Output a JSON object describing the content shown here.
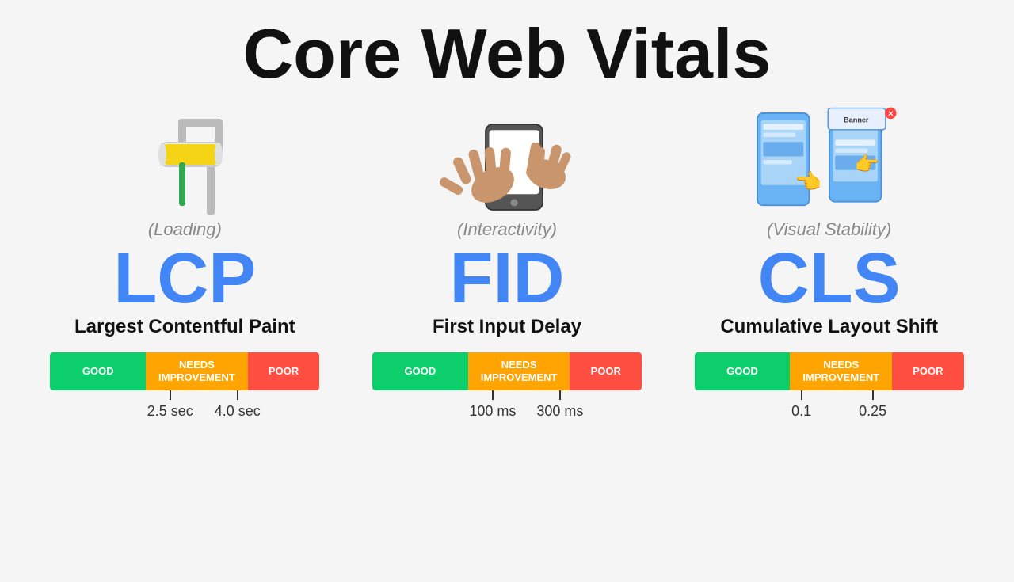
{
  "page": {
    "title": "Core Web Vitals"
  },
  "vitals": [
    {
      "id": "lcp",
      "acronym": "LCP",
      "name": "Largest Contentful Paint",
      "category": "(Loading)",
      "scale": {
        "good_label": "GOOD",
        "needs_label": "NEEDS\nIMPROVEMENT",
        "poor_label": "POOR"
      },
      "markers": [
        {
          "label": "2.5 sec",
          "position_pct": 36
        },
        {
          "label": "4.0 sec",
          "position_pct": 61
        }
      ]
    },
    {
      "id": "fid",
      "acronym": "FID",
      "name": "First Input Delay",
      "category": "(Interactivity)",
      "scale": {
        "good_label": "GOOD",
        "needs_label": "NEEDS\nIMPROVEMENT",
        "poor_label": "POOR"
      },
      "markers": [
        {
          "label": "100 ms",
          "position_pct": 36
        },
        {
          "label": "300 ms",
          "position_pct": 61
        }
      ]
    },
    {
      "id": "cls",
      "acronym": "CLS",
      "name": "Cumulative Layout Shift",
      "category": "(Visual Stability)",
      "scale": {
        "good_label": "GOOD",
        "needs_label": "NEEDS\nIMPROVEMENT",
        "poor_label": "POOR"
      },
      "markers": [
        {
          "label": "0.1",
          "position_pct": 36
        },
        {
          "label": "0.25",
          "position_pct": 61
        }
      ]
    }
  ]
}
